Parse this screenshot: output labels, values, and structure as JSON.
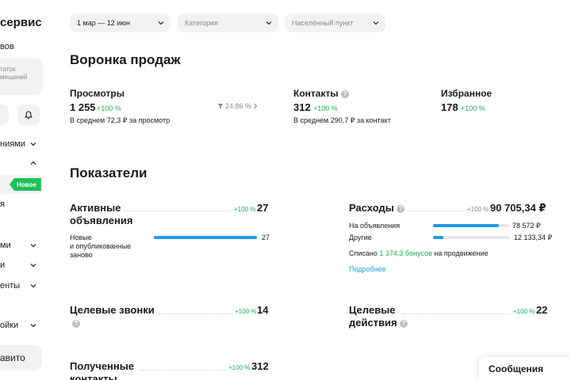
{
  "sidebar": {
    "brand": "сервис",
    "brand_sub": "вов",
    "balance_line1": "таток",
    "balance_line2": "мещений",
    "nav": [
      {
        "label": "ниями"
      },
      {
        "label": ""
      },
      {
        "label": "я"
      },
      {
        "label": "ми"
      },
      {
        "label": "и"
      },
      {
        "label": "енты"
      },
      {
        "label": "ойки"
      }
    ],
    "badge_new": "Новое",
    "cta": "авито"
  },
  "filters": {
    "period": "1 мар — 12 июн",
    "category_placeholder": "Категория",
    "location_placeholder": "Населённый пункт"
  },
  "funnel": {
    "title": "Воронка продаж",
    "views": {
      "label": "Просмотры",
      "value": "1 255",
      "growth": "+100 %",
      "note": "В среднем 72,3 ₽ за просмотр"
    },
    "conversion": "24,86 %",
    "contacts": {
      "label": "Контакты",
      "value": "312",
      "growth": "+100 %",
      "note": "В среднем 290,7 ₽ за контакт"
    },
    "favorites": {
      "label": "Избранное",
      "value": "178",
      "growth": "+100 %"
    }
  },
  "indicators": {
    "title": "Показатели",
    "active": {
      "label_line1": "Активные",
      "label_line2": "объявления",
      "growth": "+100 %",
      "value": "27",
      "sub_label_lines": [
        "Новые",
        "и опубликованные",
        "заново"
      ],
      "sub_value": "27",
      "sub_fraction": 1.0
    },
    "expenses": {
      "label": "Расходы",
      "growth": "+100 %",
      "value": "90 705,34 ₽",
      "rows": [
        {
          "label": "На объявления",
          "value": "78 572 ₽",
          "fraction": 0.866
        },
        {
          "label": "Другие",
          "value": "12 133,34 ₽",
          "fraction": 0.134
        }
      ],
      "written_off_prefix": "Списано",
      "written_off_bonus": "1 374,3 бонусов",
      "written_off_suffix": "на продвижение",
      "more_link": "Подробнее"
    },
    "calls": {
      "label": "Целевые звонки",
      "growth": "+100 %",
      "value": "14"
    },
    "actions": {
      "label_line1": "Целевые",
      "label_line2": "действия",
      "growth": "+100 %",
      "value": "22"
    },
    "received": {
      "label_line1": "Полученные",
      "label_line2": "контакты",
      "growth": "+100 %",
      "value": "312"
    }
  },
  "messages": {
    "label": "Сообщения"
  },
  "colors": {
    "accent_green": "#1fa85a",
    "accent_blue": "#1d9be8",
    "badge_green": "#1fc05a",
    "surface_grey": "#f2f2f2"
  }
}
